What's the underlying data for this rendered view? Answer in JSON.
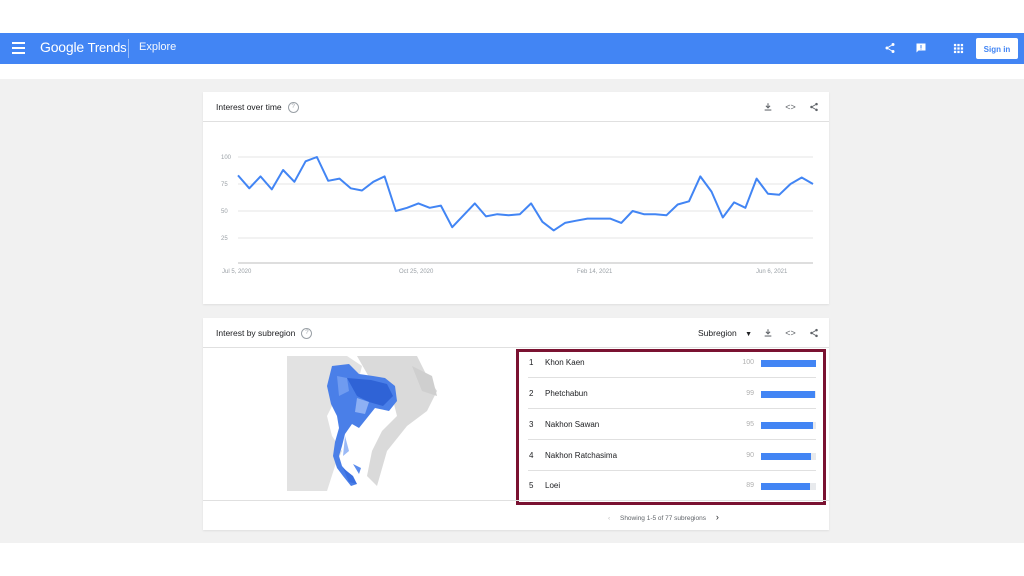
{
  "header": {
    "brand_google": "Google",
    "brand_trends": "Trends",
    "section": "Explore",
    "signin_label": "Sign in",
    "icons": [
      "share-icon",
      "feedback-icon",
      "apps-icon"
    ]
  },
  "interest_over_time": {
    "title": "Interest over time",
    "actions": [
      "download-icon",
      "embed-icon",
      "share-icon"
    ],
    "chart_data": {
      "type": "line",
      "title": "Interest over time",
      "xlabel": "",
      "ylabel": "",
      "ylim": [
        0,
        100
      ],
      "y_ticks": [
        "100",
        "75",
        "50",
        "25"
      ],
      "x_ticks": [
        "Jul 5, 2020",
        "Oct 25, 2020",
        "Feb 14, 2021",
        "Jun 6, 2021"
      ],
      "series": [
        {
          "name": "",
          "color": "#4285f4",
          "values": [
            83,
            71,
            82,
            70,
            88,
            77,
            96,
            100,
            78,
            80,
            71,
            69,
            77,
            82,
            50,
            53,
            57,
            53,
            55,
            35,
            46,
            57,
            45,
            47,
            46,
            47,
            57,
            40,
            32,
            39,
            41,
            43,
            43,
            43,
            39,
            50,
            47,
            47,
            46,
            56,
            59,
            82,
            68,
            44,
            58,
            53,
            80,
            66,
            65,
            75,
            81,
            75
          ]
        }
      ]
    }
  },
  "interest_by_subregion": {
    "title": "Interest by subregion",
    "selector_label": "Subregion",
    "actions": [
      "download-icon",
      "embed-icon",
      "share-icon"
    ],
    "rows": [
      {
        "rank": "1",
        "name": "Khon Kaen",
        "value": "100",
        "fraction": 1.0
      },
      {
        "rank": "2",
        "name": "Phetchabun",
        "value": "99",
        "fraction": 0.99
      },
      {
        "rank": "3",
        "name": "Nakhon Sawan",
        "value": "95",
        "fraction": 0.95
      },
      {
        "rank": "4",
        "name": "Nakhon Ratchasima",
        "value": "90",
        "fraction": 0.9
      },
      {
        "rank": "5",
        "name": "Loei",
        "value": "89",
        "fraction": 0.89
      }
    ],
    "pager_text": "Showing 1-5 of 77 subregions",
    "map_icon": "thailand-map"
  },
  "colors": {
    "accent": "#4285f4",
    "highlight": "#7a1231",
    "background": "#f1f1f1"
  }
}
